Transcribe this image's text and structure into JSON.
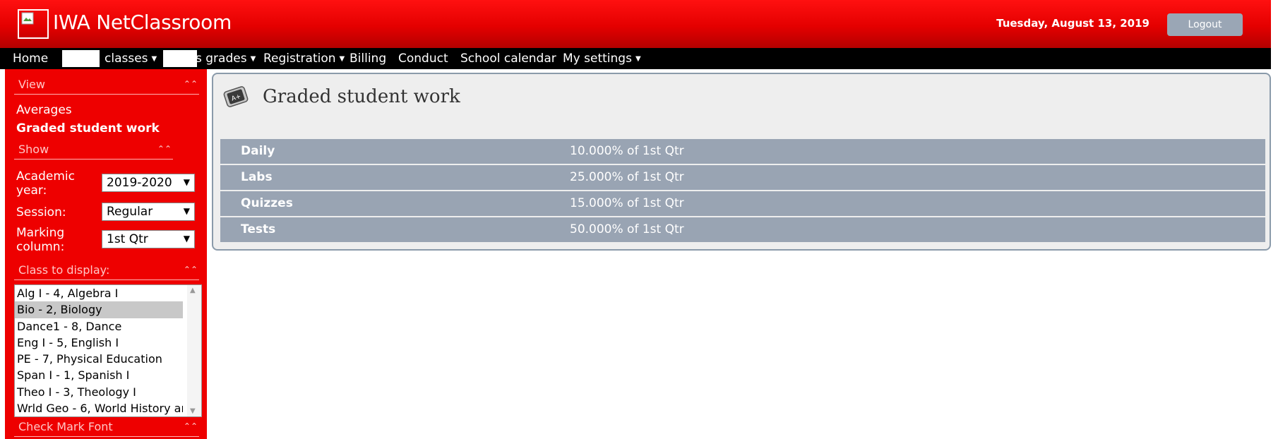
{
  "header": {
    "app_title": "IWA NetClassroom",
    "date": "Tuesday, August 13, 2019",
    "logout_label": "Logout"
  },
  "menu": {
    "items": [
      {
        "label": "Home",
        "dropdown": false
      },
      {
        "label": "classes",
        "dropdown": true
      },
      {
        "label": "s grades",
        "dropdown": true
      },
      {
        "label": "Registration",
        "dropdown": true
      },
      {
        "label": "Billing",
        "dropdown": false
      },
      {
        "label": "Conduct",
        "dropdown": false
      },
      {
        "label": "School calendar",
        "dropdown": false
      },
      {
        "label": "My settings",
        "dropdown": true
      }
    ]
  },
  "sidebar": {
    "view": {
      "heading": "View",
      "links": [
        {
          "label": "Averages",
          "active": false
        },
        {
          "label": "Graded student work",
          "active": true
        }
      ]
    },
    "show": {
      "heading": "Show",
      "academic_year_label": "Academic year:",
      "academic_year_value": "2019-2020",
      "session_label": "Session:",
      "session_value": "Regular",
      "marking_label": "Marking column:",
      "marking_value": "1st Qtr"
    },
    "class_display": {
      "heading": "Class to display:",
      "options": [
        "Alg I - 4, Algebra I",
        "Bio - 2, Biology",
        "Dance1 - 8, Dance",
        "Eng I - 5, English I",
        "PE - 7, Physical Education",
        "Span I - 1, Spanish I",
        "Theo I - 3, Theology I",
        "Wrld Geo - 6, World History ar"
      ],
      "selected": "Bio - 2, Biology"
    },
    "check_mark": {
      "heading": "Check Mark Font"
    }
  },
  "main": {
    "title": "Graded student work",
    "weights": [
      {
        "category": "Daily",
        "weight": "10.000% of 1st Qtr"
      },
      {
        "category": "Labs",
        "weight": "25.000% of 1st Qtr"
      },
      {
        "category": "Quizzes",
        "weight": "15.000% of 1st Qtr"
      },
      {
        "category": "Tests",
        "weight": "50.000% of 1st Qtr"
      }
    ]
  },
  "colors": {
    "header_red": "#e40000",
    "sidebar_red": "#ee0000",
    "menubar": "#000000",
    "weight_row": "#99a4b3",
    "logout_button": "#9aa6b5"
  }
}
